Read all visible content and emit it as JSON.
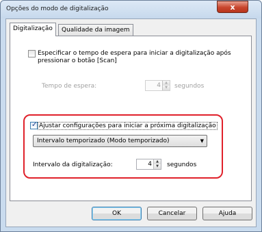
{
  "window": {
    "title": "Opções do modo de digitalização",
    "close_label": "x"
  },
  "tabs": [
    {
      "label": "Digitalização"
    },
    {
      "label": "Qualidade da imagem"
    }
  ],
  "wait_option": {
    "label_line1": "Especificar o tempo de espera para iniciar a digitalização após",
    "label_line2": "pressionar o botão [Scan]",
    "checked": false,
    "wait_time_label": "Tempo de espera:",
    "wait_time_value": "4",
    "unit": "segundos"
  },
  "next_scan": {
    "label": "Ajustar configurações para iniciar a próxima digitalização",
    "checked": true,
    "mode_selected": "Intervalo temporizado (Modo temporizado)",
    "interval_label": "Intervalo da digitalização:",
    "interval_value": "4",
    "unit": "segundos"
  },
  "buttons": {
    "ok": "OK",
    "cancel": "Cancelar",
    "help": "Ajuda"
  },
  "colors": {
    "highlight": "#e0202a",
    "close_button": "#c8462e",
    "titlebar": "#c9dbee"
  }
}
